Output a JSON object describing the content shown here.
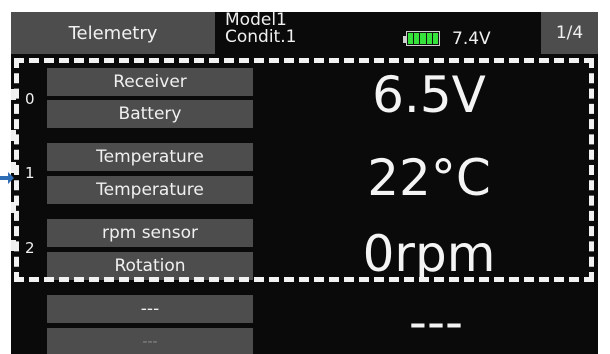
{
  "header": {
    "screen_title": "Telemetry",
    "model_line1": "Model1",
    "model_line2": "Condit.1",
    "battery_voltage": "7.4V",
    "battery_level": 1.0,
    "page_indicator": "1/4"
  },
  "rows": [
    {
      "slot": "0",
      "label_top": "Receiver",
      "label_bottom": "Battery",
      "value": "6.5V"
    },
    {
      "slot": "1",
      "label_top": "Temperature",
      "label_bottom": "Temperature",
      "value": "22°C"
    },
    {
      "slot": "2",
      "label_top": "rpm sensor",
      "label_bottom": "Rotation",
      "value": "0rpm"
    },
    {
      "slot": "",
      "label_top": "---",
      "label_bottom": "---",
      "value": "---"
    }
  ],
  "colors": {
    "screen_bg": "#0a0a0a",
    "button_bg": "#4d4d4d",
    "text": "#f0f0f0",
    "battery_fill": "#37e13b",
    "arrow": "#2f6db4"
  },
  "icons": {
    "battery": "battery-icon",
    "pointer": "arrow-right-icon"
  }
}
